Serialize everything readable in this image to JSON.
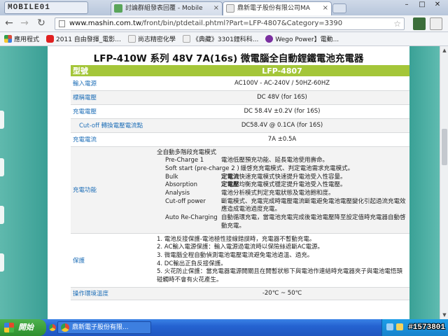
{
  "browser": {
    "logo_text": "MOBILE01",
    "tabs": [
      {
        "label": "討論群組發表回覆 - Mobile",
        "active": false
      },
      {
        "label": "鼎新電子股份有限公司MA",
        "active": true
      }
    ],
    "url": {
      "host": "www.mashin.com.tw",
      "path": "/front/bin/ptdetail.phtml?Part=LFP-4807&Category=3390"
    },
    "bookmarks": [
      {
        "label": "應用程式"
      },
      {
        "label": "2011 自由發揮_電影..."
      },
      {
        "label": "尚志精密化學"
      },
      {
        "label": "《典藏》3301鋰科科..."
      },
      {
        "label": "Wego Power】電動..."
      }
    ]
  },
  "page": {
    "title": "LFP-410W 系列 48V 7A(16s) 微電腦全自動鋰鐵電池充電器",
    "header": {
      "label": "型號",
      "value": "LFP-4807"
    },
    "rows": [
      {
        "label": "輸入電源",
        "value": "AC100V - AC-240V  / 50HZ-60HZ"
      },
      {
        "label": "標稱電壓",
        "value": "DC 48V (for 16S)"
      },
      {
        "label": "充電電壓",
        "value": "DC 58.4V ±0.2V (for 16S)"
      },
      {
        "label": "Cut-off 轉換電壓電流點",
        "value": "DC58.4V @ 0.1CA (for 16S)"
      },
      {
        "label": "充電電流",
        "value": "7A ±0.5A"
      }
    ],
    "charge_function": {
      "label": "充電功能",
      "intro": "全自動多階段充電模式",
      "modes": [
        {
          "name": "Pre-Charge 1",
          "desc_bold": "",
          "desc": "電池低壓預充功能、延長電池使用壽命。"
        },
        {
          "name": "Soft start (pre-charge 2 )",
          "desc_bold": "",
          "desc": "緩啓充充電模式、判定電池需求充電模式。"
        },
        {
          "name": "Bulk",
          "desc_bold": "定電流",
          "desc": "快速充電模式快速提升電池受入性容量。"
        },
        {
          "name": "Absorption",
          "desc_bold": "定電壓",
          "desc": "均衡充電模式穩定提升電池受入性電壓。"
        },
        {
          "name": "Analysis",
          "desc_bold": "",
          "desc": "電池分析模式判定充電狀態及電池飽和度。"
        },
        {
          "name": "Cut-off power",
          "desc_bold": "",
          "desc": "斷電模式、充電完成時電壓電流斷電避免電池電壓變化引起過流充電效應造成電池過度充電。"
        },
        {
          "name": "Auto Re-Charging",
          "desc_bold": "",
          "desc": "自動循環充電，當電池充電完成後電池電壓降至設定值時充電器自動啓動充電。"
        }
      ]
    },
    "protection": {
      "label": "保護",
      "items": [
        "1. 電池反接保護-電池極性接線錯誤時，充電器不暫動充電。",
        "2. AC輸入電源保護：輸入電源過電流時以保險絲遮斷AC電源。",
        "3. 微電腦全程自動偵測電池電壓電流避免電池過溫、過充。",
        "4. DC輸出正負反接保護。",
        "5. 火花防止保護：當充電器電源開關且在開暫狀態下與電池作連結時充電器夾子與電池電悟頭碰觸時不會有火花產生。"
      ]
    },
    "footer_row": {
      "label": "操作環境溫度",
      "value": "-20℃ ~ 50℃"
    }
  },
  "taskbar": {
    "start_label": "開始",
    "task_label": "鼎新電子股份有限...",
    "watermark": "#1573801"
  },
  "colors": {
    "accent_green": "#a4c639",
    "label_blue": "#2170b8",
    "side_teal": "#3a9f95"
  }
}
